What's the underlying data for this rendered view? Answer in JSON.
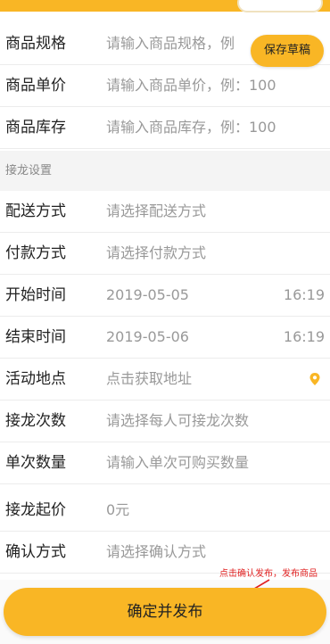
{
  "theme": {
    "accent": "#f9b625",
    "annotation_color": "#e02020"
  },
  "goods": {
    "spec": {
      "label": "商品规格",
      "placeholder": "请输入商品规格，例"
    },
    "price": {
      "label": "商品单价",
      "placeholder": "请输入商品单价，例：100"
    },
    "stock": {
      "label": "商品库存",
      "placeholder": "请输入商品库存，例：100"
    }
  },
  "draft_label": "保存草稿",
  "section_title": "接龙设置",
  "settings": {
    "delivery": {
      "label": "配送方式",
      "placeholder": "请选择配送方式"
    },
    "payment": {
      "label": "付款方式",
      "placeholder": "请选择付款方式"
    },
    "start": {
      "label": "开始时间",
      "date": "2019-05-05",
      "time": "16:19"
    },
    "end": {
      "label": "结束时间",
      "date": "2019-05-06",
      "time": "16:19"
    },
    "location": {
      "label": "活动地点",
      "placeholder": "点击获取地址",
      "icon": "location-pin-icon"
    },
    "times": {
      "label": "接龙次数",
      "placeholder": "请选择每人可接龙次数"
    },
    "quantity": {
      "label": "单次数量",
      "placeholder": "请输入单次可购买数量"
    },
    "min_price": {
      "label": "接龙起价",
      "value": "0元"
    },
    "confirm_method": {
      "label": "确认方式",
      "placeholder": "请选择确认方式"
    }
  },
  "annotation": "点击确认发布，发布商品",
  "confirm_button": "确定并发布"
}
